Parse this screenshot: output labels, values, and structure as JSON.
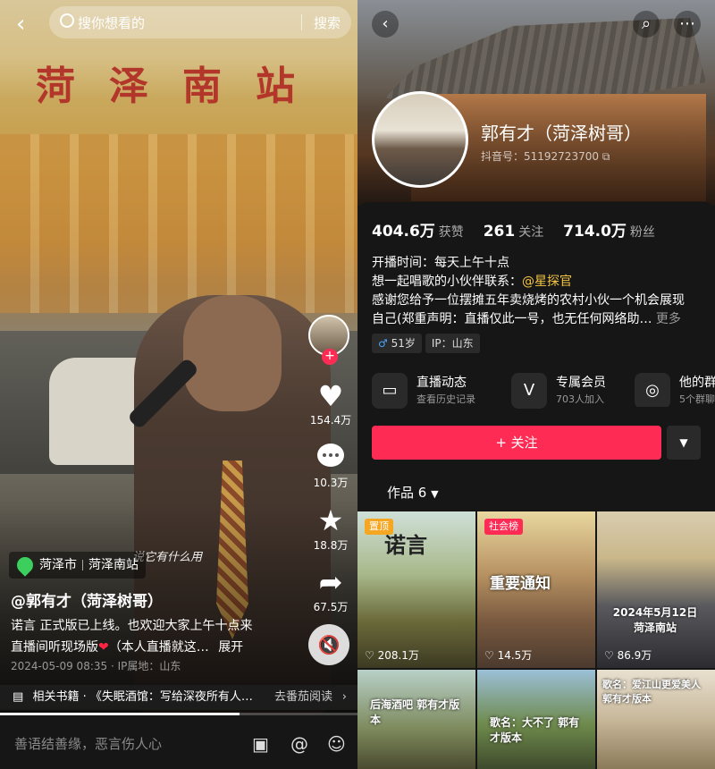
{
  "left": {
    "search": {
      "placeholder": "搜你想看的",
      "button": "搜索"
    },
    "sign_text": "菏泽南站",
    "subtitle": "说它有什么用",
    "rail": {
      "likes": "154.4万",
      "comments": "10.3万",
      "favorites": "18.8万",
      "shares": "67.5万"
    },
    "location": {
      "city": "菏泽市",
      "place": "菏泽南站"
    },
    "handle": "@郭有才（菏泽树哥）",
    "desc_line1": "诺言 正式版已上线。也欢迎大家上午十点来",
    "desc_line2": "直播间听现场版",
    "desc_line2b": "（本人直播就这…",
    "expand": "展开",
    "meta": "2024-05-09 08:35 · IP属地：山东",
    "book": {
      "label": "相关书籍 · 《失眠酒馆：写给深夜所有人…",
      "action": "去番茄阅读"
    },
    "progress": 0.67,
    "comment_placeholder": "善语结善缘，恶言伤人心"
  },
  "right": {
    "profile": {
      "name": "郭有才（菏泽树哥）",
      "id_label": "抖音号：51192723700"
    },
    "stats": {
      "likes": "404.6万",
      "likes_label": "获赞",
      "following": "261",
      "following_label": "关注",
      "fans": "714.0万",
      "fans_label": "粉丝"
    },
    "bio": {
      "line1": "开播时间：每天上午十点",
      "line2_pre": "想一起唱歌的小伙伴联系：",
      "line2_mention": "@星探官",
      "line3": "感谢您给予一位摆摊五年卖烧烤的农村小伙一个机会展现",
      "line4": "自己(郑重声明：直播仅此一号，也无任何网络助…",
      "more": "更多"
    },
    "tags": {
      "age": "51岁",
      "ip": "IP：山东"
    },
    "features": [
      {
        "title": "直播动态",
        "sub": "查看历史记录"
      },
      {
        "title": "专属会员",
        "sub": "703人加入"
      },
      {
        "title": "他的群",
        "sub": "5个群聊"
      }
    ],
    "follow_label": "+ 关注",
    "works_label": "作品 6",
    "videos": [
      {
        "badge": "置顶",
        "caption": "诺言",
        "likes": "208.1万"
      },
      {
        "badge": "社会榜",
        "caption": "重要通知",
        "likes": "14.5万"
      },
      {
        "badge": "",
        "caption": "2024年5月12日 菏泽南站",
        "likes": "86.9万"
      },
      {
        "badge": "",
        "caption": "后海酒吧 郭有才版本",
        "likes": ""
      },
      {
        "badge": "",
        "caption": "歌名：大不了 郭有才版本",
        "likes": ""
      },
      {
        "badge": "",
        "caption": "歌名：爱江山更爱美人 郭有才版本",
        "likes": ""
      }
    ]
  },
  "colors": {
    "accent": "#fe2c55",
    "mention": "#f5c542",
    "location_pin": "#3ccf5e"
  }
}
